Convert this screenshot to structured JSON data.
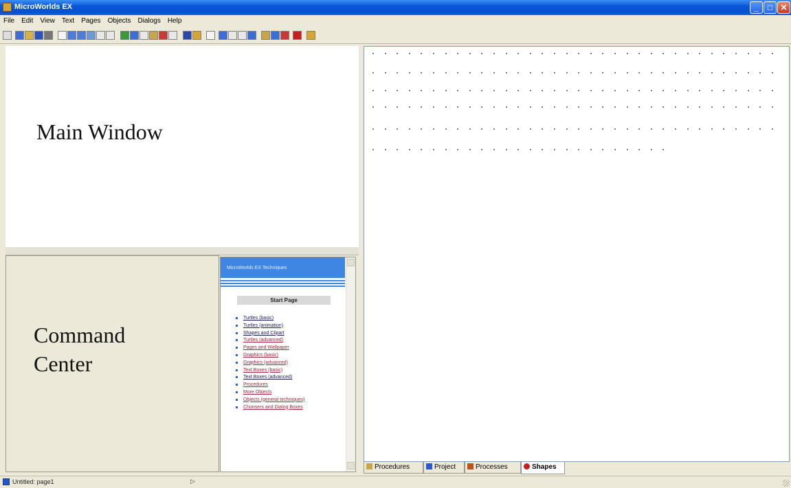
{
  "window": {
    "title": "MicroWorlds EX"
  },
  "menu": [
    "File",
    "Edit",
    "View",
    "Text",
    "Pages",
    "Objects",
    "Dialogs",
    "Help"
  ],
  "main_window": {
    "label": "Main Window"
  },
  "command_center": {
    "label_line1": "Command",
    "label_line2": "Center"
  },
  "techniques": {
    "header": "MicroWorlds EX Techniques",
    "start_page": "Start Page",
    "links": [
      "Turtles (basic)",
      "Turtles (animation)",
      "Shapes and Clipart",
      "Turtles (advanced)",
      "Pages and Wallpaper",
      "Graphics (basic)",
      "Graphics (advanced)",
      "Text Boxes (basic)",
      "Text Boxes (advanced)",
      "Procedures",
      "More Objects",
      "Objects (general techniques)",
      "Choosers and Dialog Boxes"
    ]
  },
  "tabs": [
    {
      "label": "Procedures",
      "icon": "folder-icon",
      "color": "#c8a44a"
    },
    {
      "label": "Project",
      "icon": "project-icon",
      "color": "#2a5ad0"
    },
    {
      "label": "Processes",
      "icon": "processes-icon",
      "color": "#c05020"
    },
    {
      "label": "Shapes",
      "icon": "turtle-icon",
      "color": "#c81e1e"
    }
  ],
  "active_tab": "Shapes",
  "status": {
    "text": "Untitled:  page1",
    "marker": "▷"
  }
}
